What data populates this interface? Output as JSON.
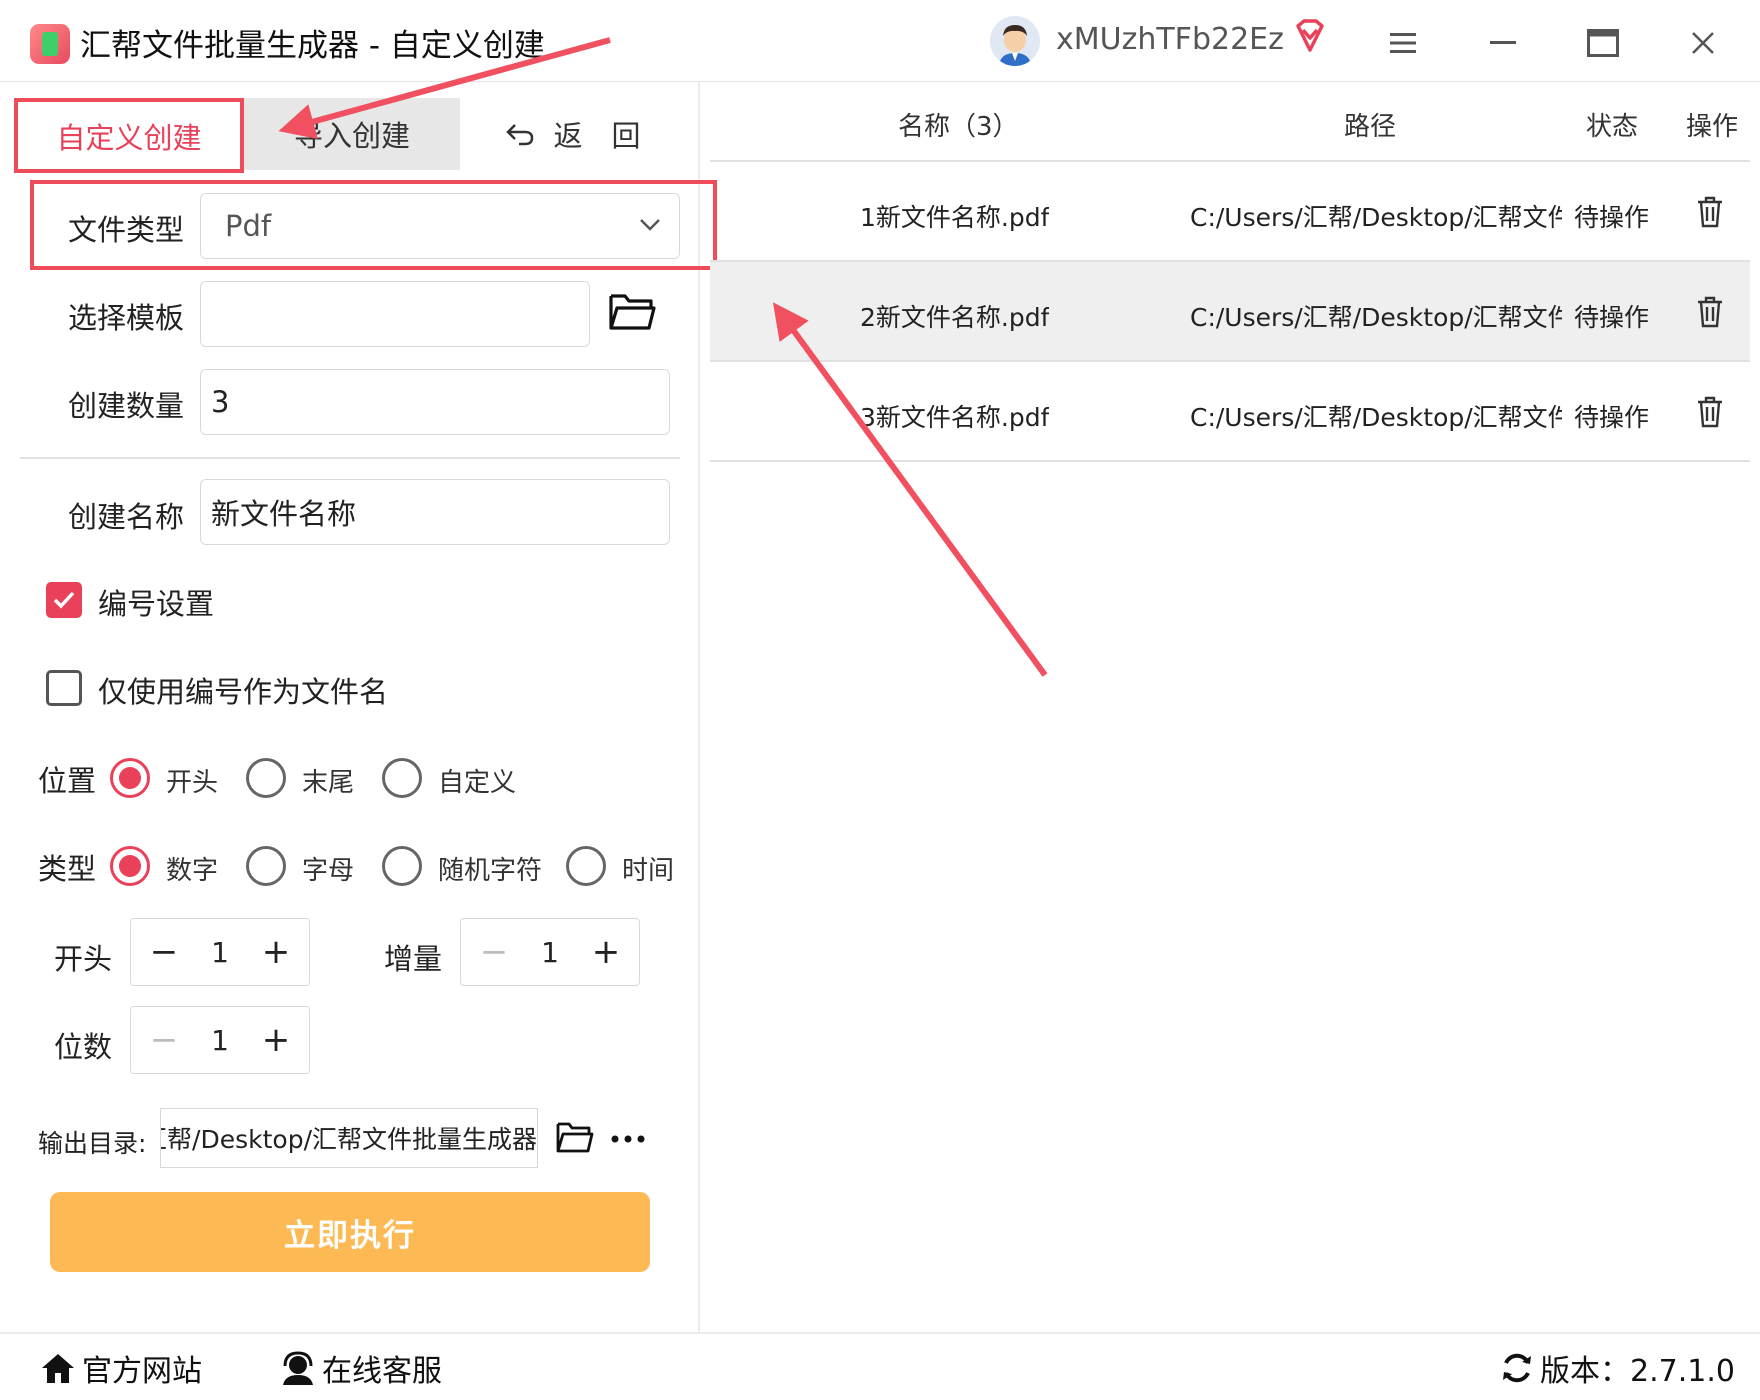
{
  "window": {
    "title": "汇帮文件批量生成器 - 自定义创建",
    "username": "xMUzhTFb22Ez"
  },
  "tabs": {
    "custom": "自定义创建",
    "import": "导入创建",
    "back": "返　回"
  },
  "form": {
    "file_type_label": "文件类型",
    "file_type_value": "Pdf",
    "template_label": "选择模板",
    "template_value": "",
    "count_label": "创建数量",
    "count_value": "3",
    "name_label": "创建名称",
    "name_value": "新文件名称",
    "numbering_label": "编号设置",
    "numbering_checked": true,
    "number_only_label": "仅使用编号作为文件名",
    "number_only_checked": false,
    "position": {
      "label": "位置",
      "options": [
        "开头",
        "末尾",
        "自定义"
      ],
      "selected": "开头"
    },
    "type": {
      "label": "类型",
      "options": [
        "数字",
        "字母",
        "随机字符",
        "时间"
      ],
      "selected": "数字"
    },
    "start": {
      "label": "开头",
      "value": "1"
    },
    "increment": {
      "label": "增量",
      "value": "1"
    },
    "digits": {
      "label": "位数",
      "value": "1"
    },
    "output_label": "输出目录:",
    "output_value": "C:/Users/汇帮/Desktop/汇帮文件批量生成器",
    "run_label": "立即执行"
  },
  "table": {
    "headers": {
      "name": "名称（3）",
      "path": "路径",
      "status": "状态",
      "action": "操作"
    },
    "rows": [
      {
        "name": "1新文件名称.pdf",
        "path": "C:/Users/汇帮/Desktop/汇帮文件",
        "status": "待操作"
      },
      {
        "name": "2新文件名称.pdf",
        "path": "C:/Users/汇帮/Desktop/汇帮文件",
        "status": "待操作"
      },
      {
        "name": "3新文件名称.pdf",
        "path": "C:/Users/汇帮/Desktop/汇帮文件",
        "status": "待操作"
      }
    ]
  },
  "footer": {
    "website": "官方网站",
    "support": "在线客服",
    "version": "版本：2.7.1.0"
  },
  "colors": {
    "accent": "#e9415a",
    "highlight": "#f04b5a",
    "run_button": "#fdb954"
  }
}
